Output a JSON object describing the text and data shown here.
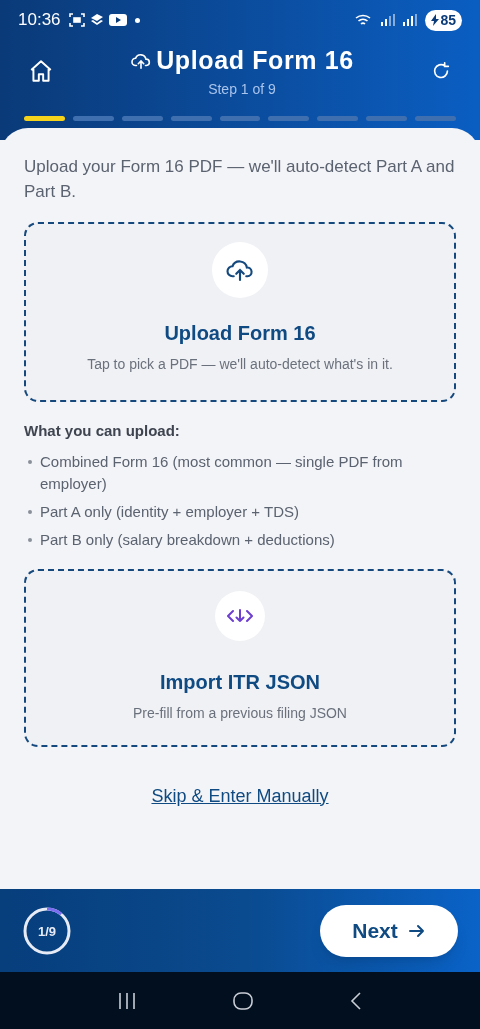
{
  "status_bar": {
    "time": "10:36",
    "battery": "85"
  },
  "header": {
    "title": "Upload Form 16",
    "subtitle": "Step 1 of 9"
  },
  "progress_segments": [
    {
      "done": true
    },
    {
      "done": false
    },
    {
      "done": false
    },
    {
      "done": false
    },
    {
      "done": false
    },
    {
      "done": false
    },
    {
      "done": false
    },
    {
      "done": false
    },
    {
      "done": false
    }
  ],
  "intro": "Upload your Form 16 PDF — we'll auto-detect Part A and Part B.",
  "upload_card": {
    "title": "Upload Form 16",
    "subtitle": "Tap to pick a PDF — we'll auto-detect what's in it."
  },
  "upload_info": {
    "heading": "What you can upload:",
    "items": [
      "Combined Form 16 (most common — single PDF from employer)",
      "Part A only (identity + employer + TDS)",
      "Part B only (salary breakdown + deductions)"
    ]
  },
  "import_card": {
    "title": "Import ITR JSON",
    "subtitle": "Pre-fill from a previous filing JSON"
  },
  "skip_link": "Skip & Enter Manually",
  "footer": {
    "step_ring": {
      "label": "1/9"
    },
    "next_button": "Next"
  }
}
